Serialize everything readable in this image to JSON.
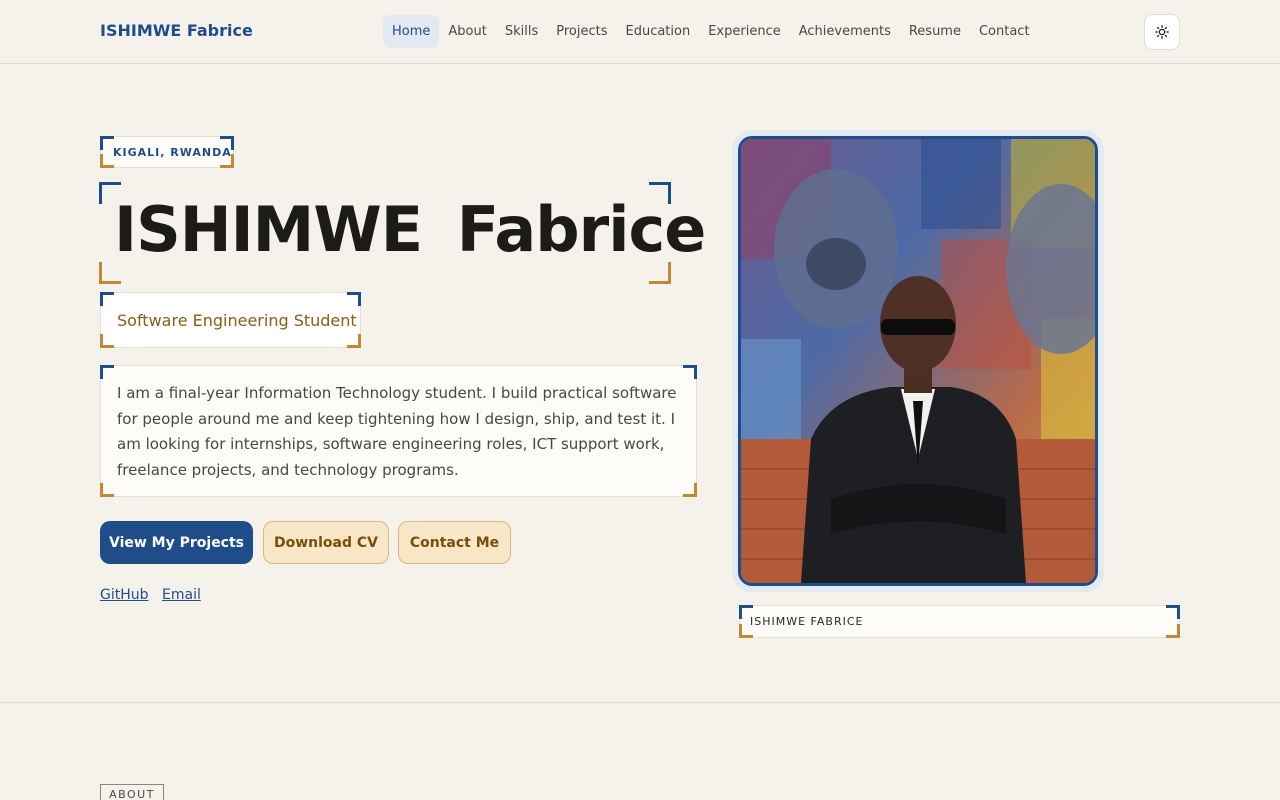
{
  "brand": "ISHIMWE Fabrice",
  "nav": {
    "items": [
      {
        "label": "Home",
        "active": true
      },
      {
        "label": "About"
      },
      {
        "label": "Skills"
      },
      {
        "label": "Projects"
      },
      {
        "label": "Education"
      },
      {
        "label": "Experience"
      },
      {
        "label": "Achievements"
      },
      {
        "label": "Resume"
      },
      {
        "label": "Contact"
      }
    ]
  },
  "theme_toggle_icon": "sun-icon",
  "hero": {
    "location": "KIGALI, RWANDA",
    "name": "ISHIMWE Fabrice",
    "role": "Software Engineering Student",
    "bio": "I am a final-year Information Technology student. I build practical software for people around me and keep tightening how I design, ship, and test it. I am looking for internships, software engineering roles, ICT support work, freelance projects, and technology programs.",
    "buttons": {
      "projects": "View My Projects",
      "cv": "Download CV",
      "contact": "Contact Me"
    },
    "links": {
      "github": "GitHub",
      "email": "Email"
    },
    "portrait_caption": "ISHIMWE FABRICE"
  },
  "about_section": {
    "tag": "ABOUT"
  },
  "colors": {
    "accent": "#1f4d8a",
    "gold": "#c08a34",
    "background": "#f5f2ec"
  }
}
